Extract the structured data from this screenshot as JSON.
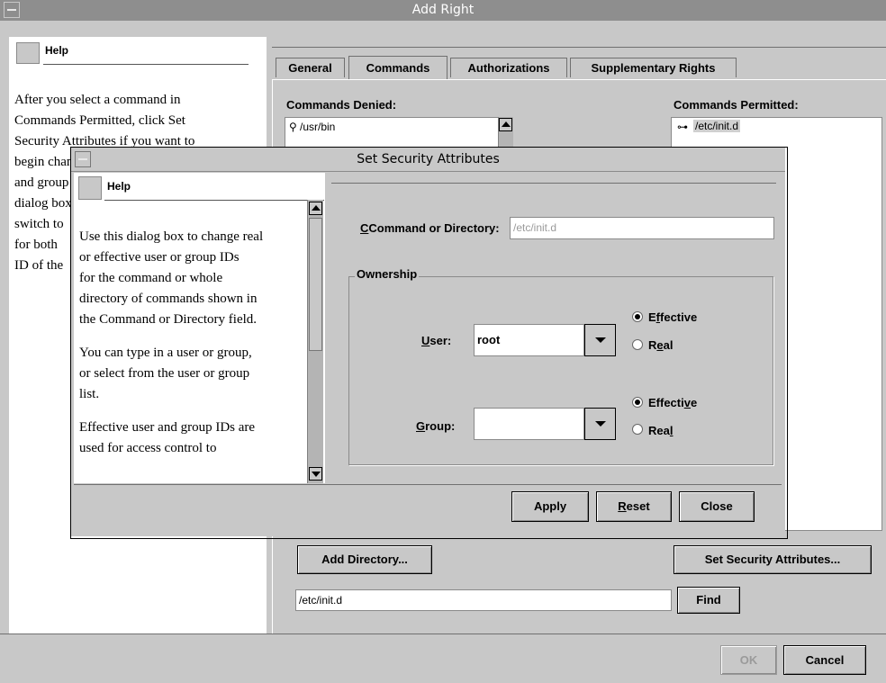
{
  "main_window": {
    "title": "Add Right",
    "help": {
      "label": "Help",
      "lines": [
        "After you select a command in",
        "Commands Permitted, click Set",
        "Security Attributes if you want to",
        "begin changing",
        "and group",
        "dialog box",
        "switch to",
        "for both",
        "ID of the"
      ]
    },
    "tabs": [
      {
        "label": "General"
      },
      {
        "label": "Commands"
      },
      {
        "label": "Authorizations"
      },
      {
        "label": "Supplementary Rights"
      }
    ],
    "commands_denied": {
      "label": "Commands Denied:",
      "items": [
        "/usr/bin"
      ]
    },
    "commands_permitted": {
      "label": "Commands Permitted:",
      "items": [
        "/etc/init.d"
      ]
    },
    "add_directory_button": "Add Directory...",
    "set_security_button": "Set Security Attributes...",
    "find_input_value": "/etc/init.d",
    "find_button": "Find",
    "ok_button": "OK",
    "cancel_button": "Cancel"
  },
  "dialog": {
    "title": "Set Security Attributes",
    "help": {
      "label": "Help",
      "paragraphs": [
        [
          "Use this dialog box to change real",
          "or effective user or group IDs",
          "for the command or whole",
          "directory of commands shown in",
          "the Command or Directory field."
        ],
        [
          "You can type in a user or group,",
          "or select from the user or group",
          "list."
        ],
        [
          "Effective user and group IDs are",
          "used for access control to"
        ]
      ]
    },
    "command_label": "Command or Directory:",
    "command_value": "/etc/init.d",
    "ownership_label": "Ownership",
    "user_label": "User:",
    "user_value": "root",
    "group_label": "Group:",
    "group_value": "",
    "user_effective": "Effective",
    "user_real": "Real",
    "group_effective": "Effective",
    "group_real": "Real",
    "apply_button": "Apply",
    "reset_button": "Reset",
    "close_button": "Close"
  }
}
